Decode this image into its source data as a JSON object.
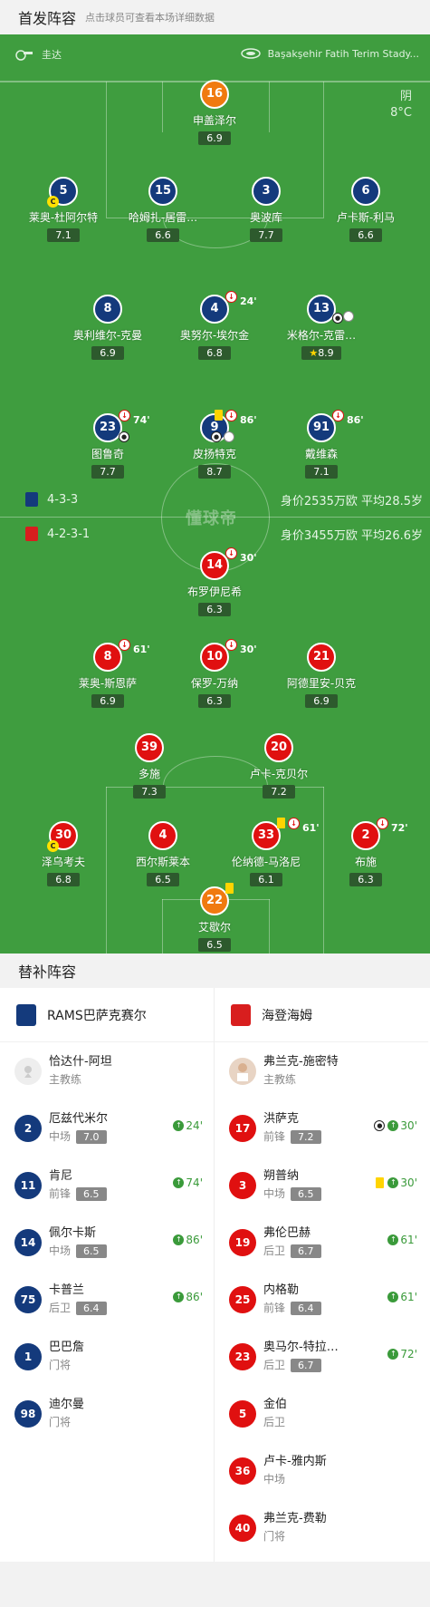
{
  "section_lineup": {
    "title": "首发阵容",
    "subtitle": "点击球员可查看本场详细数据"
  },
  "match_info": {
    "referee": "圭达",
    "venue": "Başakşehir Fatih Terim Stady...",
    "weather": "阴",
    "temperature": "8°C"
  },
  "watermark": "懂球帝",
  "home_formation": {
    "formation": "4-3-3",
    "value_text": "身价2535万欧 平均28.5岁"
  },
  "away_formation": {
    "formation": "4-2-3-1",
    "value_text": "身价3455万欧 平均26.6岁"
  },
  "home_players": [
    {
      "number": "16",
      "name": "申盖泽尔",
      "rating": "6.9"
    },
    {
      "number": "5",
      "name": "莱奥-杜阿尔特",
      "rating": "7.1",
      "captain": "C"
    },
    {
      "number": "15",
      "name": "哈姆扎-居雷…",
      "rating": "6.6"
    },
    {
      "number": "3",
      "name": "奥波库",
      "rating": "7.7"
    },
    {
      "number": "6",
      "name": "卢卡斯-利马",
      "rating": "6.6"
    },
    {
      "number": "8",
      "name": "奥利维尔-克曼",
      "rating": "6.9"
    },
    {
      "number": "4",
      "name": "奥努尔-埃尔金",
      "rating": "6.8",
      "sub_time": "24'"
    },
    {
      "number": "13",
      "name": "米格尔-克雷…",
      "rating": "8.9"
    },
    {
      "number": "23",
      "name": "图鲁奇",
      "rating": "7.7",
      "sub_time": "74'"
    },
    {
      "number": "9",
      "name": "皮扬特克",
      "rating": "8.7",
      "sub_time": "86'"
    },
    {
      "number": "91",
      "name": "戴维森",
      "rating": "7.1",
      "sub_time": "86'"
    }
  ],
  "away_players": [
    {
      "number": "14",
      "name": "布罗伊尼希",
      "rating": "6.3",
      "sub_time": "30'"
    },
    {
      "number": "8",
      "name": "莱奥-斯恩萨",
      "rating": "6.9",
      "sub_time": "61'"
    },
    {
      "number": "10",
      "name": "保罗-万纳",
      "rating": "6.3",
      "sub_time": "30'"
    },
    {
      "number": "21",
      "name": "阿德里安-贝克",
      "rating": "6.9"
    },
    {
      "number": "39",
      "name": "多施",
      "rating": "7.3"
    },
    {
      "number": "20",
      "name": "卢卡-克贝尔",
      "rating": "7.2"
    },
    {
      "number": "30",
      "name": "泽乌考夫",
      "rating": "6.8",
      "captain": "C"
    },
    {
      "number": "4",
      "name": "西尔斯莱本",
      "rating": "6.5"
    },
    {
      "number": "33",
      "name": "伦纳德-马洛尼",
      "rating": "6.1",
      "sub_time": "61'"
    },
    {
      "number": "2",
      "name": "布施",
      "rating": "6.3",
      "sub_time": "72'"
    },
    {
      "number": "22",
      "name": "艾歇尔",
      "rating": "6.5"
    }
  ],
  "section_subs": {
    "title": "替补阵容"
  },
  "home_team": {
    "name": "RAMS巴萨克赛尔"
  },
  "away_team": {
    "name": "海登海姆"
  },
  "home_coach": {
    "name": "恰达什-阿坦",
    "role": "主教练"
  },
  "away_coach": {
    "name": "弗兰克-施密特",
    "role": "主教练"
  },
  "home_subs": [
    {
      "number": "2",
      "name": "厄兹代米尔",
      "pos": "中场",
      "rating": "7.0",
      "in": "24'"
    },
    {
      "number": "11",
      "name": "肯尼",
      "pos": "前锋",
      "rating": "6.5",
      "in": "74'"
    },
    {
      "number": "14",
      "name": "佩尔卡斯",
      "pos": "中场",
      "rating": "6.5",
      "in": "86'"
    },
    {
      "number": "75",
      "name": "卡普兰",
      "pos": "后卫",
      "rating": "6.4",
      "in": "86'"
    },
    {
      "number": "1",
      "name": "巴巴詹",
      "pos": "门将"
    },
    {
      "number": "98",
      "name": "迪尔曼",
      "pos": "门将"
    }
  ],
  "away_subs": [
    {
      "number": "17",
      "name": "洪萨克",
      "pos": "前锋",
      "rating": "7.2",
      "in": "30'"
    },
    {
      "number": "3",
      "name": "朔普纳",
      "pos": "中场",
      "rating": "6.5",
      "in": "30'"
    },
    {
      "number": "19",
      "name": "弗伦巴赫",
      "pos": "后卫",
      "rating": "6.7",
      "in": "61'"
    },
    {
      "number": "25",
      "name": "内格勒",
      "pos": "前锋",
      "rating": "6.4",
      "in": "61'"
    },
    {
      "number": "23",
      "name": "奥马尔-特拉…",
      "pos": "后卫",
      "rating": "6.7",
      "in": "72'"
    },
    {
      "number": "5",
      "name": "金伯",
      "pos": "后卫"
    },
    {
      "number": "36",
      "name": "卢卡-雅内斯",
      "pos": "中场"
    },
    {
      "number": "40",
      "name": "弗兰克-费勒",
      "pos": "门将"
    }
  ],
  "colors": {
    "pitch": "#3f9d3f",
    "home": "#143a7c",
    "away": "#e01010",
    "gk": "#f07a10",
    "sub_in": "#3a9a3a"
  }
}
